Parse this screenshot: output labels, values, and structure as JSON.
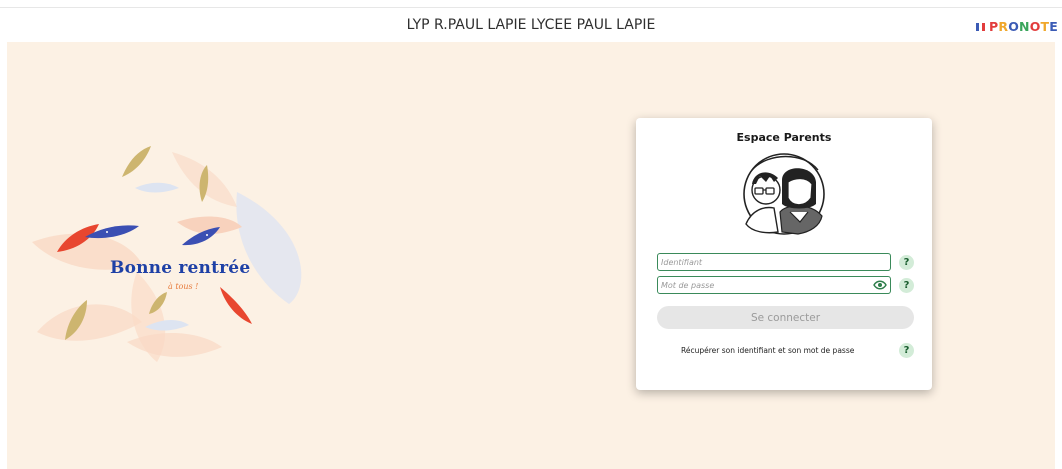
{
  "header": {
    "school_name": "LYP R.PAUL LAPIE LYCEE PAUL LAPIE",
    "brand_letters": [
      "P",
      "R",
      "O",
      "N",
      "O",
      "T",
      "E"
    ],
    "brand_colors": [
      "#e23c3c",
      "#f0a72b",
      "#3b5bb5",
      "#3aa55b",
      "#e23c3c",
      "#f0a72b",
      "#3b5bb5"
    ]
  },
  "welcome": {
    "title": "Bonne rentrée",
    "subtitle": "à tous !"
  },
  "login": {
    "title": "Espace Parents",
    "username_placeholder": "Identifiant",
    "password_placeholder": "Mot de passe",
    "help_glyph": "?",
    "connect_label": "Se connecter",
    "recover_label": "Récupérer son identifiant et son mot de passe"
  },
  "colors": {
    "background": "#fcf1e4",
    "field_border": "#3a8a5a",
    "help_bg": "#d3ecd8",
    "welcome_text": "#1e40a6"
  }
}
